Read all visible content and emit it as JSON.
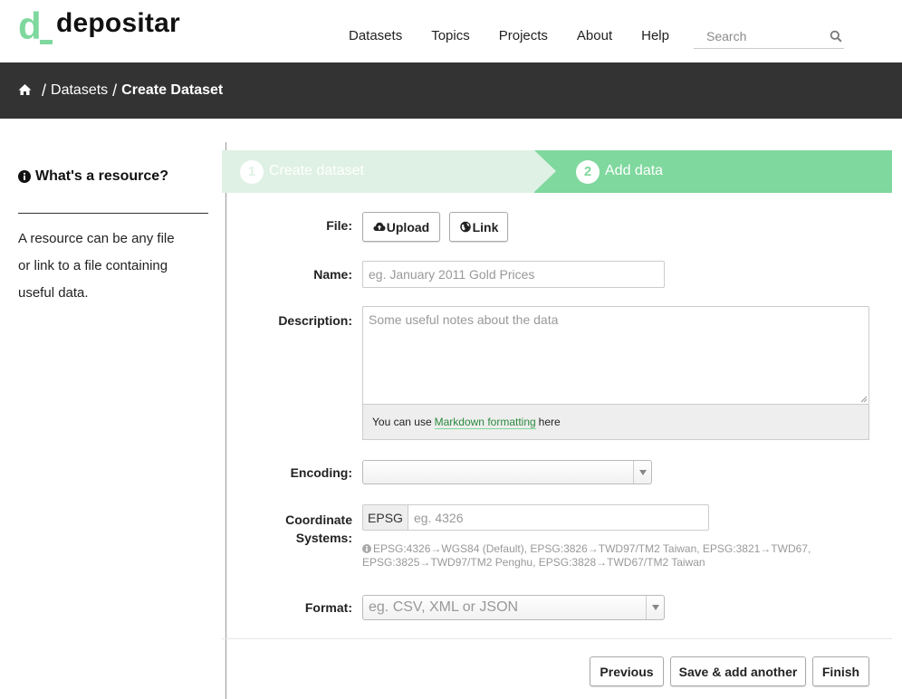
{
  "brand": {
    "mark": "d",
    "name": "depositar",
    "color": "#7fd89d"
  },
  "nav": {
    "items": [
      "Datasets",
      "Topics",
      "Projects",
      "About",
      "Help"
    ]
  },
  "search": {
    "placeholder": "Search",
    "icon": "search-icon"
  },
  "breadcrumb": {
    "home_icon": "home-icon",
    "sep": "/",
    "datasets": "Datasets",
    "current": "Create Dataset"
  },
  "sidebar": {
    "title": "What's a resource?",
    "icon": "info-icon",
    "lines": [
      "A resource can be any file",
      "or link to a file containing",
      "useful data."
    ]
  },
  "stages": {
    "step1": {
      "num": "1",
      "label": "Create dataset"
    },
    "step2": {
      "num": "2",
      "label": "Add data"
    }
  },
  "form": {
    "file": {
      "label": "File:",
      "upload": "Upload",
      "link": "Link"
    },
    "name": {
      "label": "Name:",
      "placeholder": "eg. January 2011 Gold Prices"
    },
    "description": {
      "label": "Description:",
      "placeholder": "Some useful notes about the data",
      "md_prefix": "You can use",
      "md_link": "Markdown formatting",
      "md_suffix": "here"
    },
    "encoding": {
      "label": "Encoding:",
      "value": ""
    },
    "crs": {
      "label_line1": "Coordinate",
      "label_line2": "Systems:",
      "addon": "EPSG",
      "placeholder": "eg. 4326",
      "help_line1": "EPSG:4326→WGS84 (Default), EPSG:3826→TWD97/TM2 Taiwan, EPSG:3821→TWD67,",
      "help_line2": "EPSG:3825→TWD97/TM2 Penghu, EPSG:3828→TWD67/TM2 Taiwan"
    },
    "format": {
      "label": "Format:",
      "placeholder": "eg. CSV, XML or JSON"
    }
  },
  "actions": {
    "previous": "Previous",
    "save_add": "Save & add another",
    "finish": "Finish"
  }
}
